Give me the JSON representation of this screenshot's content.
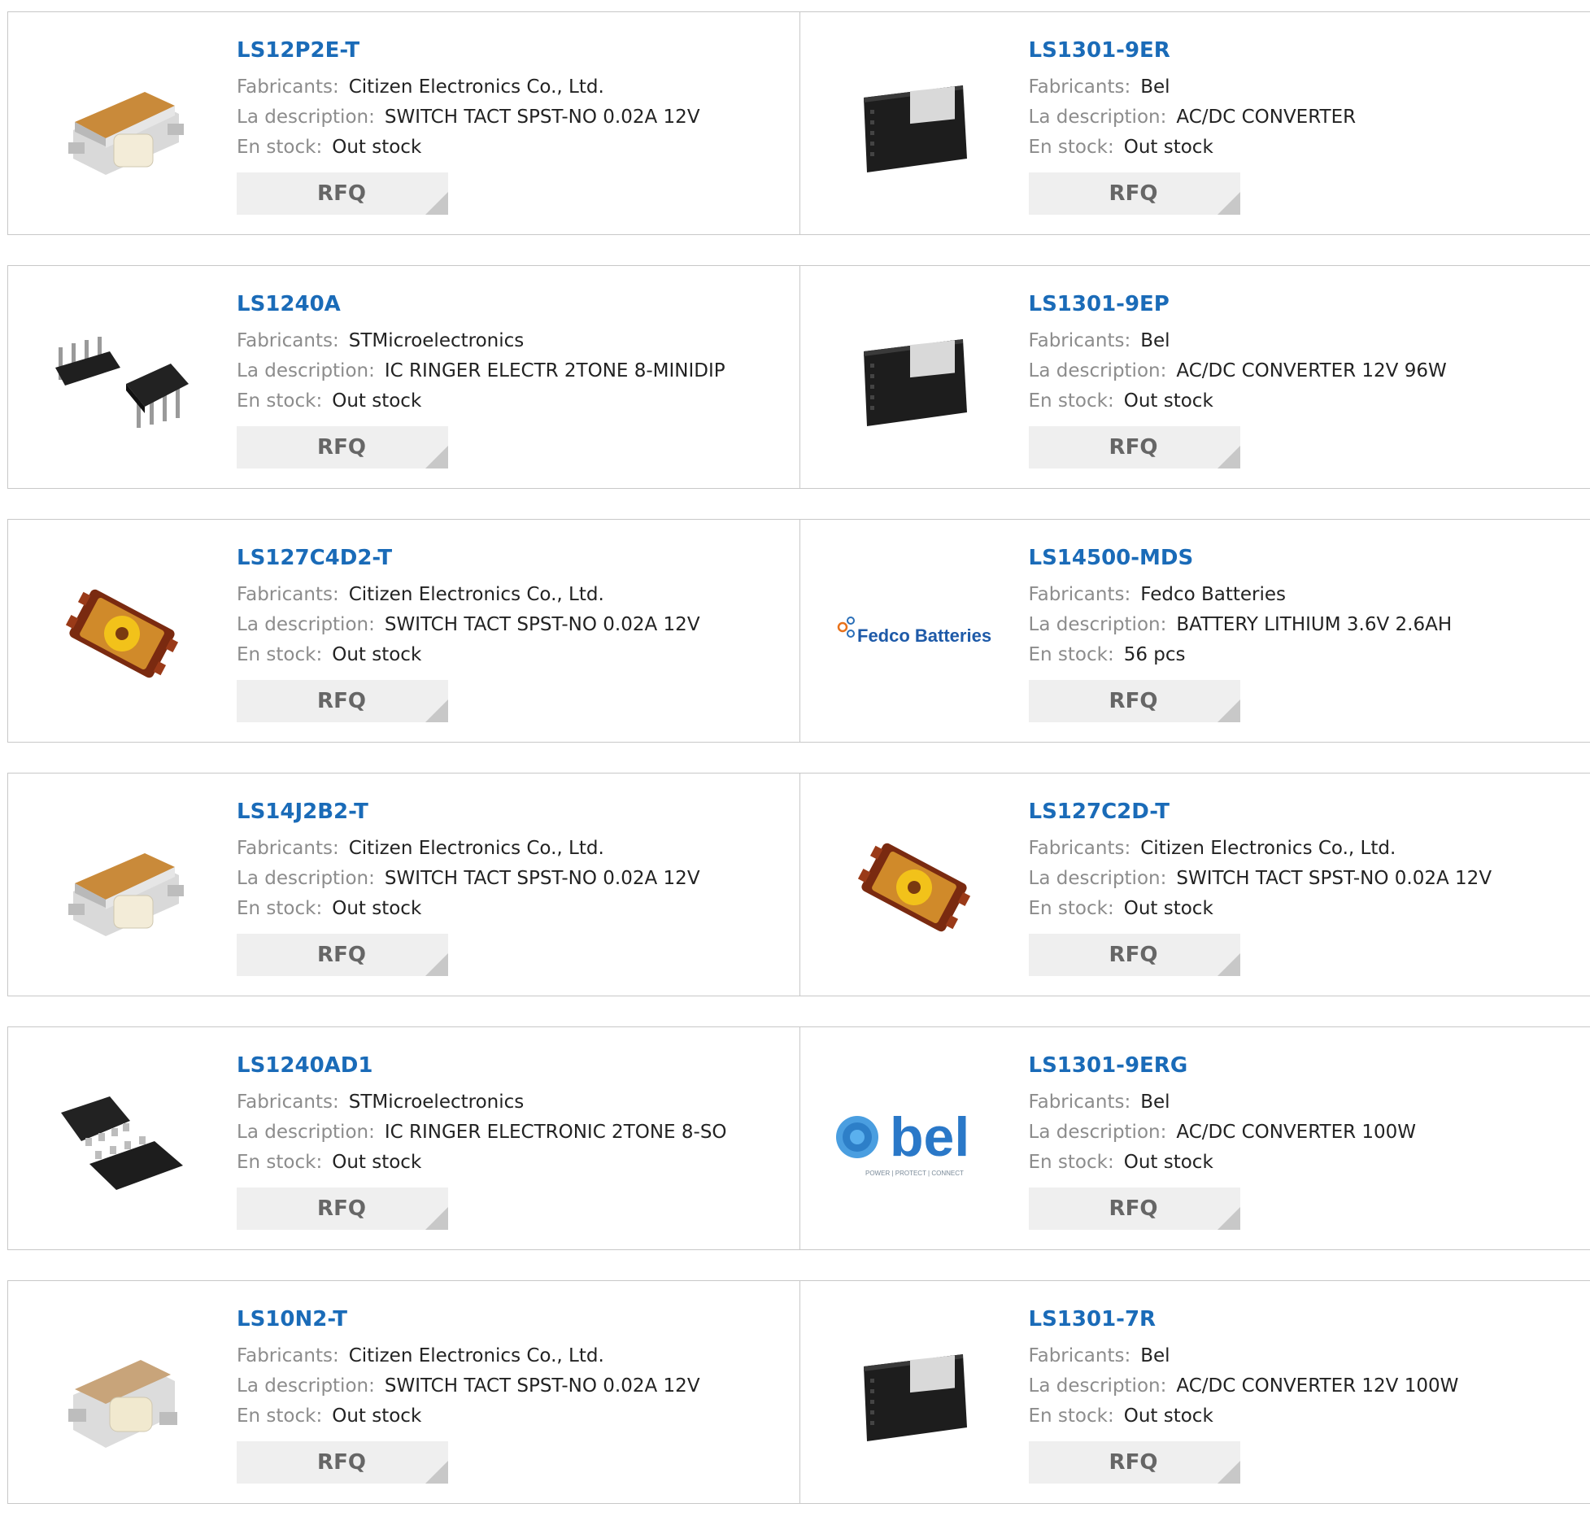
{
  "labels": {
    "manufacturer": "Fabricants:",
    "description": "La description:",
    "stock": "En stock:",
    "rfq": "RFQ"
  },
  "products": [
    {
      "part": "LS12P2E-T",
      "manufacturer": "Citizen Electronics Co., Ltd.",
      "description": "SWITCH TACT SPST-NO 0.02A 12V",
      "stock": "Out stock",
      "image": "tact-switch-side"
    },
    {
      "part": "LS1301-9ER",
      "manufacturer": "Bel",
      "description": "AC/DC CONVERTER",
      "stock": "Out stock",
      "image": "power-converter"
    },
    {
      "part": "LS1240A",
      "manufacturer": "STMicroelectronics",
      "description": "IC RINGER ELECTR 2TONE 8-MINIDIP",
      "stock": "Out stock",
      "image": "dip-ic"
    },
    {
      "part": "LS1301-9EP",
      "manufacturer": "Bel",
      "description": "AC/DC CONVERTER 12V 96W",
      "stock": "Out stock",
      "image": "power-converter"
    },
    {
      "part": "LS127C4D2-T",
      "manufacturer": "Citizen Electronics Co., Ltd.",
      "description": "SWITCH TACT SPST-NO 0.02A 12V",
      "stock": "Out stock",
      "image": "tact-switch-top"
    },
    {
      "part": "LS14500-MDS",
      "manufacturer": "Fedco Batteries",
      "description": "BATTERY LITHIUM 3.6V 2.6AH",
      "stock": "56 pcs",
      "image": "fedco-logo",
      "logo_text": "Fedco Batteries"
    },
    {
      "part": "LS14J2B2-T",
      "manufacturer": "Citizen Electronics Co., Ltd.",
      "description": "SWITCH TACT SPST-NO 0.02A 12V",
      "stock": "Out stock",
      "image": "tact-switch-side"
    },
    {
      "part": "LS127C2D-T",
      "manufacturer": "Citizen Electronics Co., Ltd.",
      "description": "SWITCH TACT SPST-NO 0.02A 12V",
      "stock": "Out stock",
      "image": "tact-switch-top"
    },
    {
      "part": "LS1240AD1",
      "manufacturer": "STMicroelectronics",
      "description": "IC RINGER ELECTRONIC 2TONE 8-SO",
      "stock": "Out stock",
      "image": "so-ic"
    },
    {
      "part": "LS1301-9ERG",
      "manufacturer": "Bel",
      "description": "AC/DC CONVERTER 100W",
      "stock": "Out stock",
      "image": "bel-logo",
      "logo_text": "bel",
      "logo_tagline": "POWER | PROTECT | CONNECT"
    },
    {
      "part": "LS10N2-T",
      "manufacturer": "Citizen Electronics Co., Ltd.",
      "description": "SWITCH TACT SPST-NO 0.02A 12V",
      "stock": "Out stock",
      "image": "tact-switch-small"
    },
    {
      "part": "LS1301-7R",
      "manufacturer": "Bel",
      "description": "AC/DC CONVERTER 12V 100W",
      "stock": "Out stock",
      "image": "power-converter"
    }
  ]
}
